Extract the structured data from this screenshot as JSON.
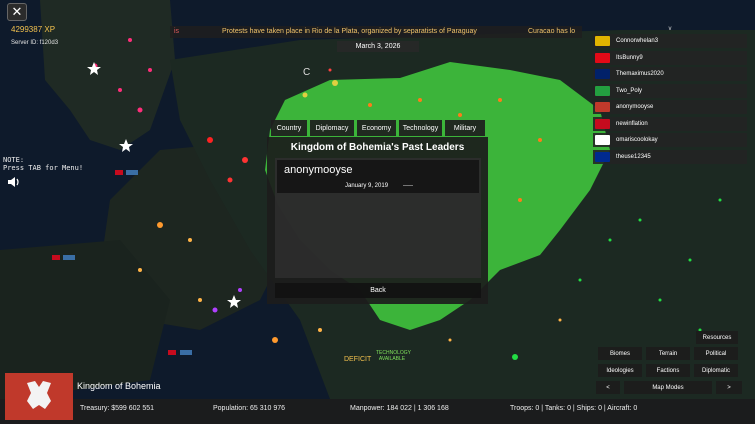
{
  "hud": {
    "close_icon": "✕",
    "xp": "4299387 XP",
    "server_id": "Server ID: f120d3",
    "note_line1": "NOTE:",
    "note_line2": "Press TAB for Menu!"
  },
  "ticker": {
    "left_fragment": "is",
    "headline": "Protests have taken place in Rio de la Plata, organized by separatists of Paraguay",
    "right_fragment": "Curacao has lo"
  },
  "date": "March 3, 2026",
  "players": {
    "header": "v",
    "list": [
      {
        "name": "Connorwhelan3",
        "flag_color": "#e0b400"
      },
      {
        "name": "ItsBunny9",
        "flag_color": "#e30a17"
      },
      {
        "name": "Themaximus2020",
        "flag_color": "#012169"
      },
      {
        "name": "Two_Poly",
        "flag_color": "#239f40"
      },
      {
        "name": "anonymooyse",
        "flag_color": "#c0392b"
      },
      {
        "name": "newinflation",
        "flag_color": "#c60b1e"
      },
      {
        "name": "omariscoolokay",
        "flag_color": "#ffffff"
      },
      {
        "name": "theuse12345",
        "flag_color": "#002a8f"
      }
    ]
  },
  "tabs": [
    "Country",
    "Diplomacy",
    "Economy",
    "Technology",
    "Military"
  ],
  "dialog": {
    "title": "Kingdom of Bohemia's Past Leaders",
    "leader": {
      "name": "anonymooyse",
      "start": "January 9, 2019",
      "end": "-----"
    },
    "back_label": "Back"
  },
  "map_labels": {
    "c_marker": "C",
    "deficit": "DEFICIT",
    "tech_available": "TECHNOLOGY AVAILABLE"
  },
  "country": {
    "name": "Kingdom of Bohemia",
    "banner_color": "#c0392b"
  },
  "stats": {
    "treasury": "Treasury:  $599 602 551",
    "population": "Population: 65 310 976",
    "manpower": "Manpower:  184 022  |  1 306 168",
    "troops": "Troops: 0  |  Tanks: 0  |  Ships: 0  |  Aircraft: 0"
  },
  "map_modes": {
    "resources": "Resources",
    "biomes": "Biomes",
    "terrain": "Terrain",
    "political": "Political",
    "ideologies": "Ideologies",
    "factions": "Factions",
    "diplomatic": "Diplomatic",
    "prev": "<",
    "label": "Map Modes",
    "next": ">"
  }
}
